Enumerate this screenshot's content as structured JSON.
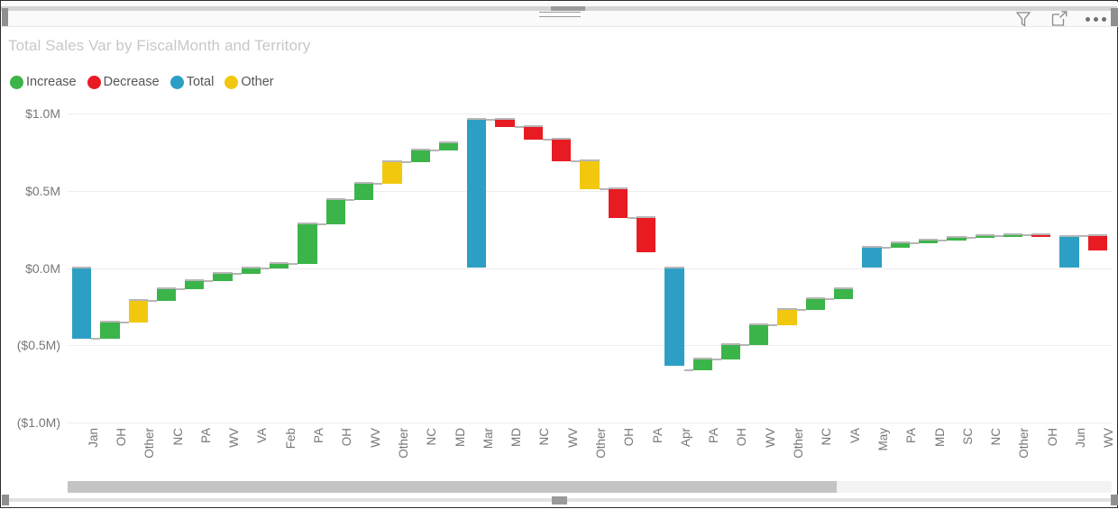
{
  "header": {
    "icons": [
      {
        "name": "filter-icon",
        "label": "Filters"
      },
      {
        "name": "focus-mode-icon",
        "label": "Focus mode"
      },
      {
        "name": "more-options-icon",
        "label": "More options"
      }
    ]
  },
  "chart_title": "Total Sales Var by FiscalMonth and Territory",
  "legend": {
    "items": [
      {
        "label": "Increase",
        "color": "#3BB44A"
      },
      {
        "label": "Decrease",
        "color": "#E81B23"
      },
      {
        "label": "Total",
        "color": "#2E9FC4"
      },
      {
        "label": "Other",
        "color": "#F2C80F"
      }
    ]
  },
  "scrollbar": {
    "orientation": "horizontal",
    "thumb_fraction": 0.737
  },
  "chart_data": {
    "type": "bar",
    "subtype": "waterfall",
    "title": "Total Sales Var by FiscalMonth and Territory",
    "xlabel": "",
    "ylabel": "",
    "ylim": [
      -1000000,
      1000000
    ],
    "ytick_values": [
      1000000,
      500000,
      0,
      -500000,
      -1000000
    ],
    "ytick_labels": [
      "$1.0M",
      "$0.5M",
      "$0.0M",
      "($0.5M)",
      "($1.0M)"
    ],
    "grid": true,
    "legend_position": "top-left",
    "value_unit": "USD",
    "categories": [
      "Jan",
      "OH",
      "Other",
      "NC",
      "PA",
      "WV",
      "VA",
      "Feb",
      "PA",
      "OH",
      "WV",
      "Other",
      "NC",
      "MD",
      "Mar",
      "MD",
      "NC",
      "WV",
      "Other",
      "OH",
      "PA",
      "Apr",
      "PA",
      "OH",
      "WV",
      "Other",
      "NC",
      "VA",
      "May",
      "PA",
      "MD",
      "SC",
      "NC",
      "Other",
      "OH",
      "Jun",
      "WV"
    ],
    "bar_types": [
      "Total",
      "Increase",
      "Other",
      "Increase",
      "Increase",
      "Increase",
      "Increase",
      "Increase",
      "Increase",
      "Increase",
      "Increase",
      "Other",
      "Increase",
      "Increase",
      "Total",
      "Decrease",
      "Decrease",
      "Decrease",
      "Other",
      "Decrease",
      "Decrease",
      "Total",
      "Increase",
      "Increase",
      "Increase",
      "Other",
      "Increase",
      "Increase",
      "Total",
      "Increase",
      "Increase",
      "Increase",
      "Increase",
      "Increase",
      "Decrease",
      "Total",
      "Decrease"
    ],
    "deltas": [
      -460000,
      110000,
      140000,
      75000,
      50000,
      45000,
      35000,
      30000,
      260000,
      155000,
      105000,
      140000,
      75000,
      50000,
      960000,
      -45000,
      -85000,
      -140000,
      -180000,
      -185000,
      -225000,
      -630000,
      70000,
      90000,
      130000,
      100000,
      70000,
      65000,
      130000,
      30000,
      20000,
      15000,
      10000,
      10000,
      -10000,
      200000,
      -90000
    ],
    "cumulative_start": [
      0,
      -460000,
      -350000,
      -210000,
      -135000,
      -85000,
      -40000,
      -5000,
      25000,
      285000,
      440000,
      545000,
      685000,
      760000,
      0,
      960000,
      915000,
      830000,
      690000,
      510000,
      325000,
      0,
      -660000,
      -590000,
      -500000,
      -370000,
      -270000,
      -200000,
      0,
      130000,
      160000,
      180000,
      195000,
      205000,
      215000,
      0,
      205000
    ],
    "cumulative_end": [
      -460000,
      -350000,
      -210000,
      -135000,
      -85000,
      -40000,
      -5000,
      25000,
      285000,
      440000,
      545000,
      685000,
      760000,
      810000,
      960000,
      915000,
      830000,
      690000,
      510000,
      325000,
      100000,
      -630000,
      -590000,
      -500000,
      -370000,
      -270000,
      -200000,
      -135000,
      130000,
      160000,
      180000,
      195000,
      205000,
      215000,
      205000,
      200000,
      115000
    ]
  }
}
